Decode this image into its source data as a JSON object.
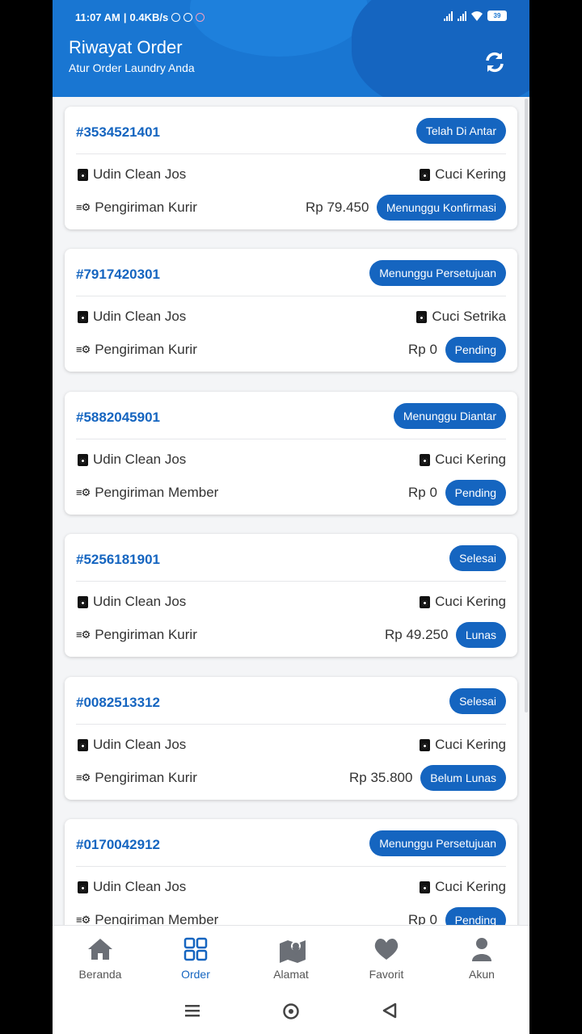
{
  "status_bar": {
    "time": "11:07 AM",
    "speed": "0.4KB/s",
    "battery": "39"
  },
  "header": {
    "title": "Riwayat Order",
    "subtitle": "Atur Order Laundry Anda",
    "refresh_icon": "refresh-icon"
  },
  "orders": [
    {
      "id": "#3534521401",
      "status": "Telah Di Antar",
      "store": "Udin Clean Jos",
      "service": "Cuci Kering",
      "delivery": "Pengiriman Kurir",
      "price": "Rp 79.450",
      "payment": "Menunggu Konfirmasi"
    },
    {
      "id": "#7917420301",
      "status": "Menunggu Persetujuan",
      "store": "Udin Clean Jos",
      "service": "Cuci Setrika",
      "delivery": "Pengiriman Kurir",
      "price": "Rp 0",
      "payment": "Pending"
    },
    {
      "id": "#5882045901",
      "status": "Menunggu Diantar",
      "store": "Udin Clean Jos",
      "service": "Cuci Kering",
      "delivery": "Pengiriman Member",
      "price": "Rp 0",
      "payment": "Pending"
    },
    {
      "id": "#5256181901",
      "status": "Selesai",
      "store": "Udin Clean Jos",
      "service": "Cuci Kering",
      "delivery": "Pengiriman Kurir",
      "price": "Rp 49.250",
      "payment": "Lunas"
    },
    {
      "id": "#0082513312",
      "status": "Selesai",
      "store": "Udin Clean Jos",
      "service": "Cuci Kering",
      "delivery": "Pengiriman Kurir",
      "price": "Rp 35.800",
      "payment": "Belum Lunas"
    },
    {
      "id": "#0170042912",
      "status": "Menunggu Persetujuan",
      "store": "Udin Clean Jos",
      "service": "Cuci Kering",
      "delivery": "Pengiriman Member",
      "price": "Rp 0",
      "payment": "Pending"
    }
  ],
  "nav": [
    {
      "label": "Beranda",
      "icon": "home-icon"
    },
    {
      "label": "Order",
      "icon": "grid-icon",
      "active": true
    },
    {
      "label": "Alamat",
      "icon": "map-icon"
    },
    {
      "label": "Favorit",
      "icon": "heart-icon"
    },
    {
      "label": "Akun",
      "icon": "user-icon"
    }
  ],
  "colors": {
    "primary": "#1976d2",
    "pill": "#1565c0",
    "background": "#f4f5f7"
  }
}
